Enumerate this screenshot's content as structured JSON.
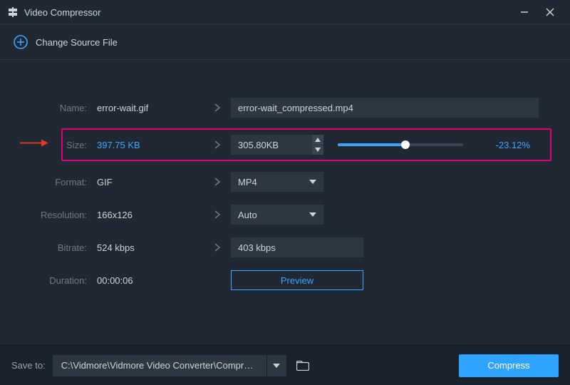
{
  "header": {
    "title": "Video Compressor"
  },
  "source": {
    "change_label": "Change Source File"
  },
  "labels": {
    "name": "Name:",
    "size": "Size:",
    "format": "Format:",
    "resolution": "Resolution:",
    "bitrate": "Bitrate:",
    "duration": "Duration:"
  },
  "current": {
    "name": "error-wait.gif",
    "size": "397.75 KB",
    "format": "GIF",
    "resolution": "166x126",
    "bitrate": "524 kbps",
    "duration": "00:00:06"
  },
  "target": {
    "name": "error-wait_compressed.mp4",
    "size": "305.80KB",
    "format": "MP4",
    "resolution": "Auto",
    "bitrate": "403 kbps"
  },
  "size_slider": {
    "percent_label": "-23.12%",
    "fill_pct": 54
  },
  "preview_label": "Preview",
  "footer": {
    "save_to_label": "Save to:",
    "path": "C:\\Vidmore\\Vidmore Video Converter\\Compressed",
    "compress_label": "Compress"
  }
}
